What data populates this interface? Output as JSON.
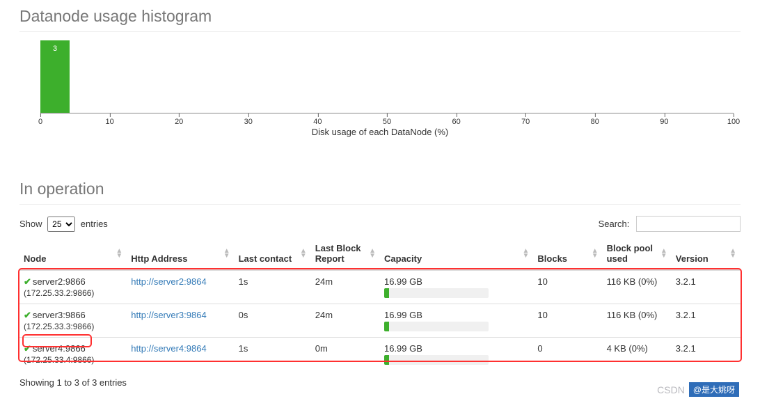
{
  "histogram": {
    "title": "Datanode usage histogram",
    "xlabel": "Disk usage of each DataNode (%)",
    "bar_value": "3",
    "ticks": [
      "0",
      "10",
      "20",
      "30",
      "40",
      "50",
      "60",
      "70",
      "80",
      "90",
      "100"
    ]
  },
  "chart_data": {
    "type": "bar",
    "title": "Datanode usage histogram",
    "xlabel": "Disk usage of each DataNode (%)",
    "ylabel": "",
    "x_range": [
      0,
      100
    ],
    "categories": [
      "0-10",
      "10-20",
      "20-30",
      "30-40",
      "40-50",
      "50-60",
      "60-70",
      "70-80",
      "80-90",
      "90-100"
    ],
    "values": [
      3,
      0,
      0,
      0,
      0,
      0,
      0,
      0,
      0,
      0
    ],
    "ylim": [
      0,
      3
    ]
  },
  "operation": {
    "title": "In operation",
    "show_label": "Show",
    "entries_label": "entries",
    "page_size": "25",
    "search_label": "Search:",
    "search_value": ""
  },
  "table": {
    "columns": {
      "node": "Node",
      "http": "Http Address",
      "last_contact": "Last contact",
      "last_block": "Last Block Report",
      "capacity": "Capacity",
      "blocks": "Blocks",
      "pool_used": "Block pool used",
      "version": "Version"
    },
    "rows": [
      {
        "host": "server2:9866",
        "ip": "(172.25.33.2:9866)",
        "http": "http://server2:9864",
        "last_contact": "1s",
        "last_block": "24m",
        "capacity": "16.99 GB",
        "capacity_pct": 5,
        "blocks": "10",
        "pool_used": "116 KB (0%)",
        "version": "3.2.1"
      },
      {
        "host": "server3:9866",
        "ip": "(172.25.33.3:9866)",
        "http": "http://server3:9864",
        "last_contact": "0s",
        "last_block": "24m",
        "capacity": "16.99 GB",
        "capacity_pct": 5,
        "blocks": "10",
        "pool_used": "116 KB (0%)",
        "version": "3.2.1"
      },
      {
        "host": "server4:9866",
        "ip": "(172.25.33.4:9866)",
        "http": "http://server4:9864",
        "last_contact": "1s",
        "last_block": "0m",
        "capacity": "16.99 GB",
        "capacity_pct": 5,
        "blocks": "0",
        "pool_used": "4 KB (0%)",
        "version": "3.2.1"
      }
    ],
    "info": "Showing 1 to 3 of 3 entries"
  },
  "watermark": {
    "left": "CSDN",
    "right": "@是大姚呀"
  }
}
